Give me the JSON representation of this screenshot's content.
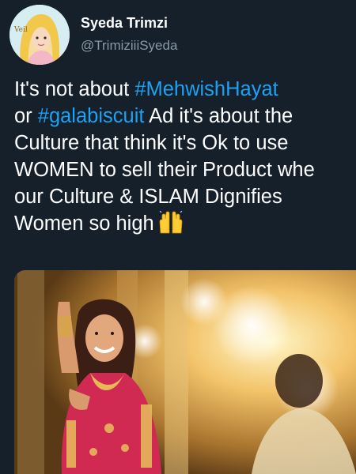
{
  "tweet": {
    "author": {
      "display_name": "Syeda Trimzi",
      "handle": "@TrimiziiiSyeda",
      "avatar_text": "Veil"
    },
    "text": {
      "line1_before": "It's not about ",
      "hashtag1": "#MehwishHayat",
      "line2_before": "or ",
      "hashtag2": "#galabiscuit",
      "line2_after": " Ad it's about the",
      "line3": "Culture that think it's Ok to use",
      "line4": "WOMEN to sell their Product whe",
      "line5": "our Culture & ISLAM Dignifies",
      "line6": "Women so high",
      "emoji": "raising-hands-icon"
    },
    "media": {
      "type": "photo",
      "description_icon": "dancing-woman-photo"
    }
  },
  "colors": {
    "background": "#15202b",
    "text": "#ffffff",
    "secondary_text": "#8899a6",
    "link": "#1da1f2"
  }
}
